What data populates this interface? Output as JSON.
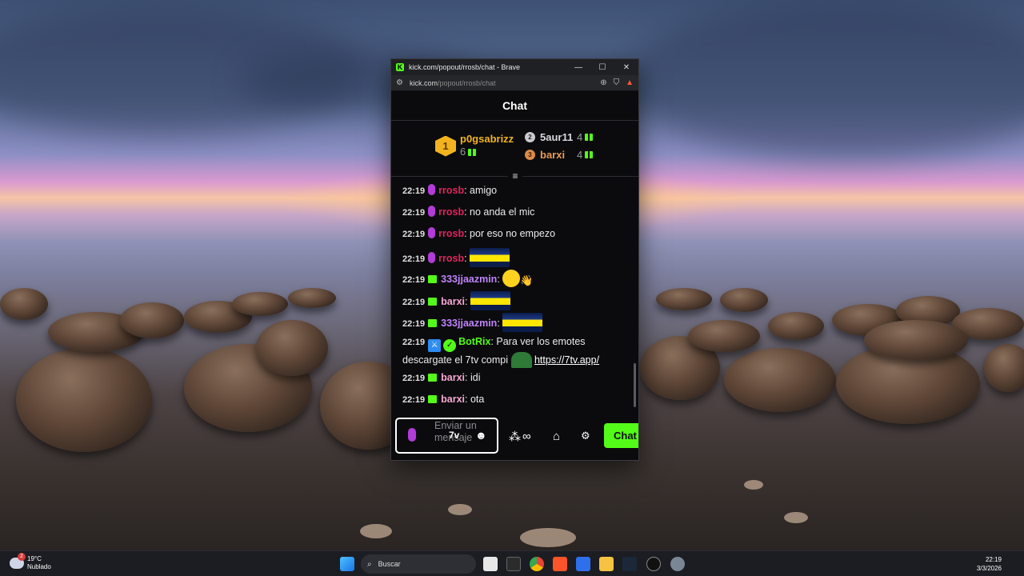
{
  "browser": {
    "title": "kick.com/popout/rrosb/chat - Brave",
    "url_host": "kick.com",
    "url_path": "/popout/rrosb/chat"
  },
  "chat": {
    "header": "Chat",
    "leaderboard": {
      "first": {
        "rank": "1",
        "name": "p0gsabrizz",
        "count": "6"
      },
      "second": {
        "rank": "2",
        "name": "5aur11",
        "count": "4"
      },
      "third": {
        "rank": "3",
        "name": "barxi",
        "count": "4"
      }
    },
    "messages": [
      {
        "time": "22:19",
        "user": "rrosb",
        "text": "amigo"
      },
      {
        "time": "22:19",
        "user": "rrosb",
        "text": "no anda el mic"
      },
      {
        "time": "22:19",
        "user": "rrosb",
        "text": "por eso no empezo"
      },
      {
        "time": "22:19",
        "user": "rrosb",
        "text": ""
      },
      {
        "time": "22:19",
        "user": "333jjaazmin",
        "text": ""
      },
      {
        "time": "22:19",
        "user": "barxi",
        "text": ""
      },
      {
        "time": "22:19",
        "user": "333jjaazmin",
        "text": ""
      },
      {
        "time": "22:19",
        "user": "BotRix",
        "text": "Para ver los emotes descargate el 7tv compi",
        "link": "https://7tv.app/"
      },
      {
        "time": "22:19",
        "user": "barxi",
        "text": "idi"
      },
      {
        "time": "22:19",
        "user": "barxi",
        "text": "ota"
      }
    ],
    "composer": {
      "placeholder": "Enviar un mensaje",
      "seventv_label": "7v"
    },
    "send_label": "Chat",
    "colors": {
      "accent": "#53fc18",
      "rrosb": "#e0245e",
      "333jjaazmin": "#c084fc",
      "barxi": "#f9a8d4",
      "BotRix": "#53fc18"
    }
  },
  "taskbar": {
    "weather_temp": "19°C",
    "weather_desc": "Nublado",
    "search_placeholder": "Buscar",
    "time": "22:19",
    "date": "3/3/2026"
  }
}
